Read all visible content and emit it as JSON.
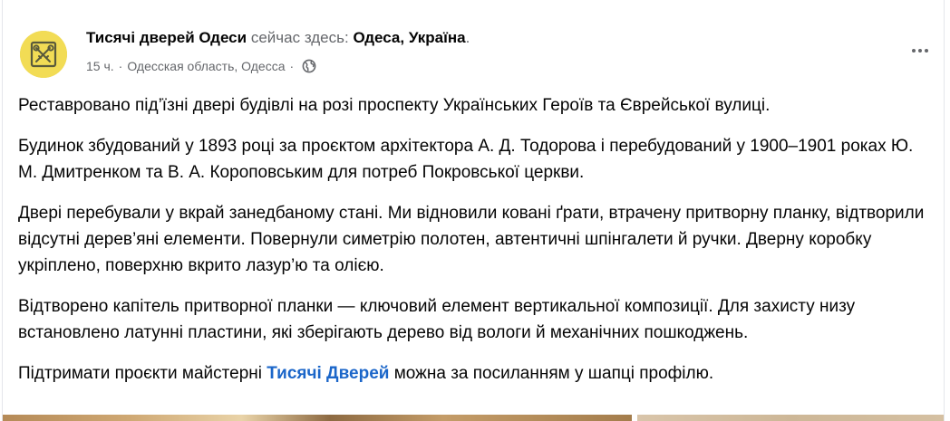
{
  "post": {
    "page_name": "Тисячі дверей Одеси",
    "location_prefix": "сейчас здесь:",
    "location_name": "Одеса, Україна",
    "location_suffix": ".",
    "time": "15 ч.",
    "meta_separator": "·",
    "place": "Одесская область, Одесса",
    "icons": {
      "avatar": "keys-logo-avatar",
      "privacy": "globe-icon",
      "more": "more-options-icon"
    }
  },
  "body": {
    "p1": "Реставровано під’їзні двері будівлі на розі проспекту Українських Героїв та Єврейської вулиці.",
    "p2": "Будинок збудований у 1893 році за проєктом архітектора А. Д. Тодорова і перебудований у 1900–1901 роках Ю. М. Дмитренком та В. А. Короповським для потреб Покровської церкви.",
    "p3": "Двері перебували у вкрай занедбаному стані. Ми відновили ковані ґрати, втрачену притворну планку, відтворили відсутні дерев’яні елементи. Повернули симетрію полотен, автентичні шпінгалети й ручки. Дверну коробку укріплено, поверхню вкрито лазур’ю та олією.",
    "p4": "Відтворено капітель притворної планки — ключовий елемент вертикальної композиції. Для захисту низу встановлено латунні пластини, які зберігають дерево від вологи й механічних пошкоджень.",
    "p5_before": "Підтримати проєкти майстерні ",
    "p5_link": "Тисячі Дверей",
    "p5_after": " можна за посиланням у шапці профілю."
  },
  "colors": {
    "text": "#050505",
    "secondary_text": "#65676b",
    "link": "#1b66c9",
    "avatar_background": "#f2dc55"
  }
}
